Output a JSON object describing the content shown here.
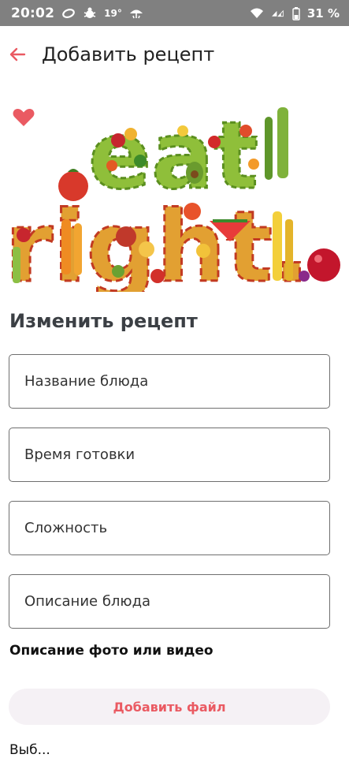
{
  "status_bar": {
    "time": "20:02",
    "temperature": "19°",
    "battery": "31 %",
    "icons": [
      "sync-icon",
      "bug-icon",
      "weather-icon",
      "wifi-icon",
      "signal-icon",
      "battery-icon"
    ]
  },
  "app_bar": {
    "title": "Добавить рецепт",
    "back_icon": "arrow-left-icon"
  },
  "hero": {
    "favorite_icon": "heart-icon",
    "image_lettering": "eat right."
  },
  "form": {
    "heading": "Изменить рецепт",
    "fields": {
      "dish_name": "Название блюда",
      "cook_time": "Время готовки",
      "difficulty": "Сложность",
      "description": "Описание блюда"
    },
    "media_label": "Описание фото или видео",
    "add_file_button": "Добавить файл",
    "next_line_partial": "Выб..."
  },
  "colors": {
    "accent": "#ea5a62",
    "status_bar_bg": "#808080",
    "field_border": "#6f6f6f",
    "button_bg": "#f5f1f5"
  }
}
